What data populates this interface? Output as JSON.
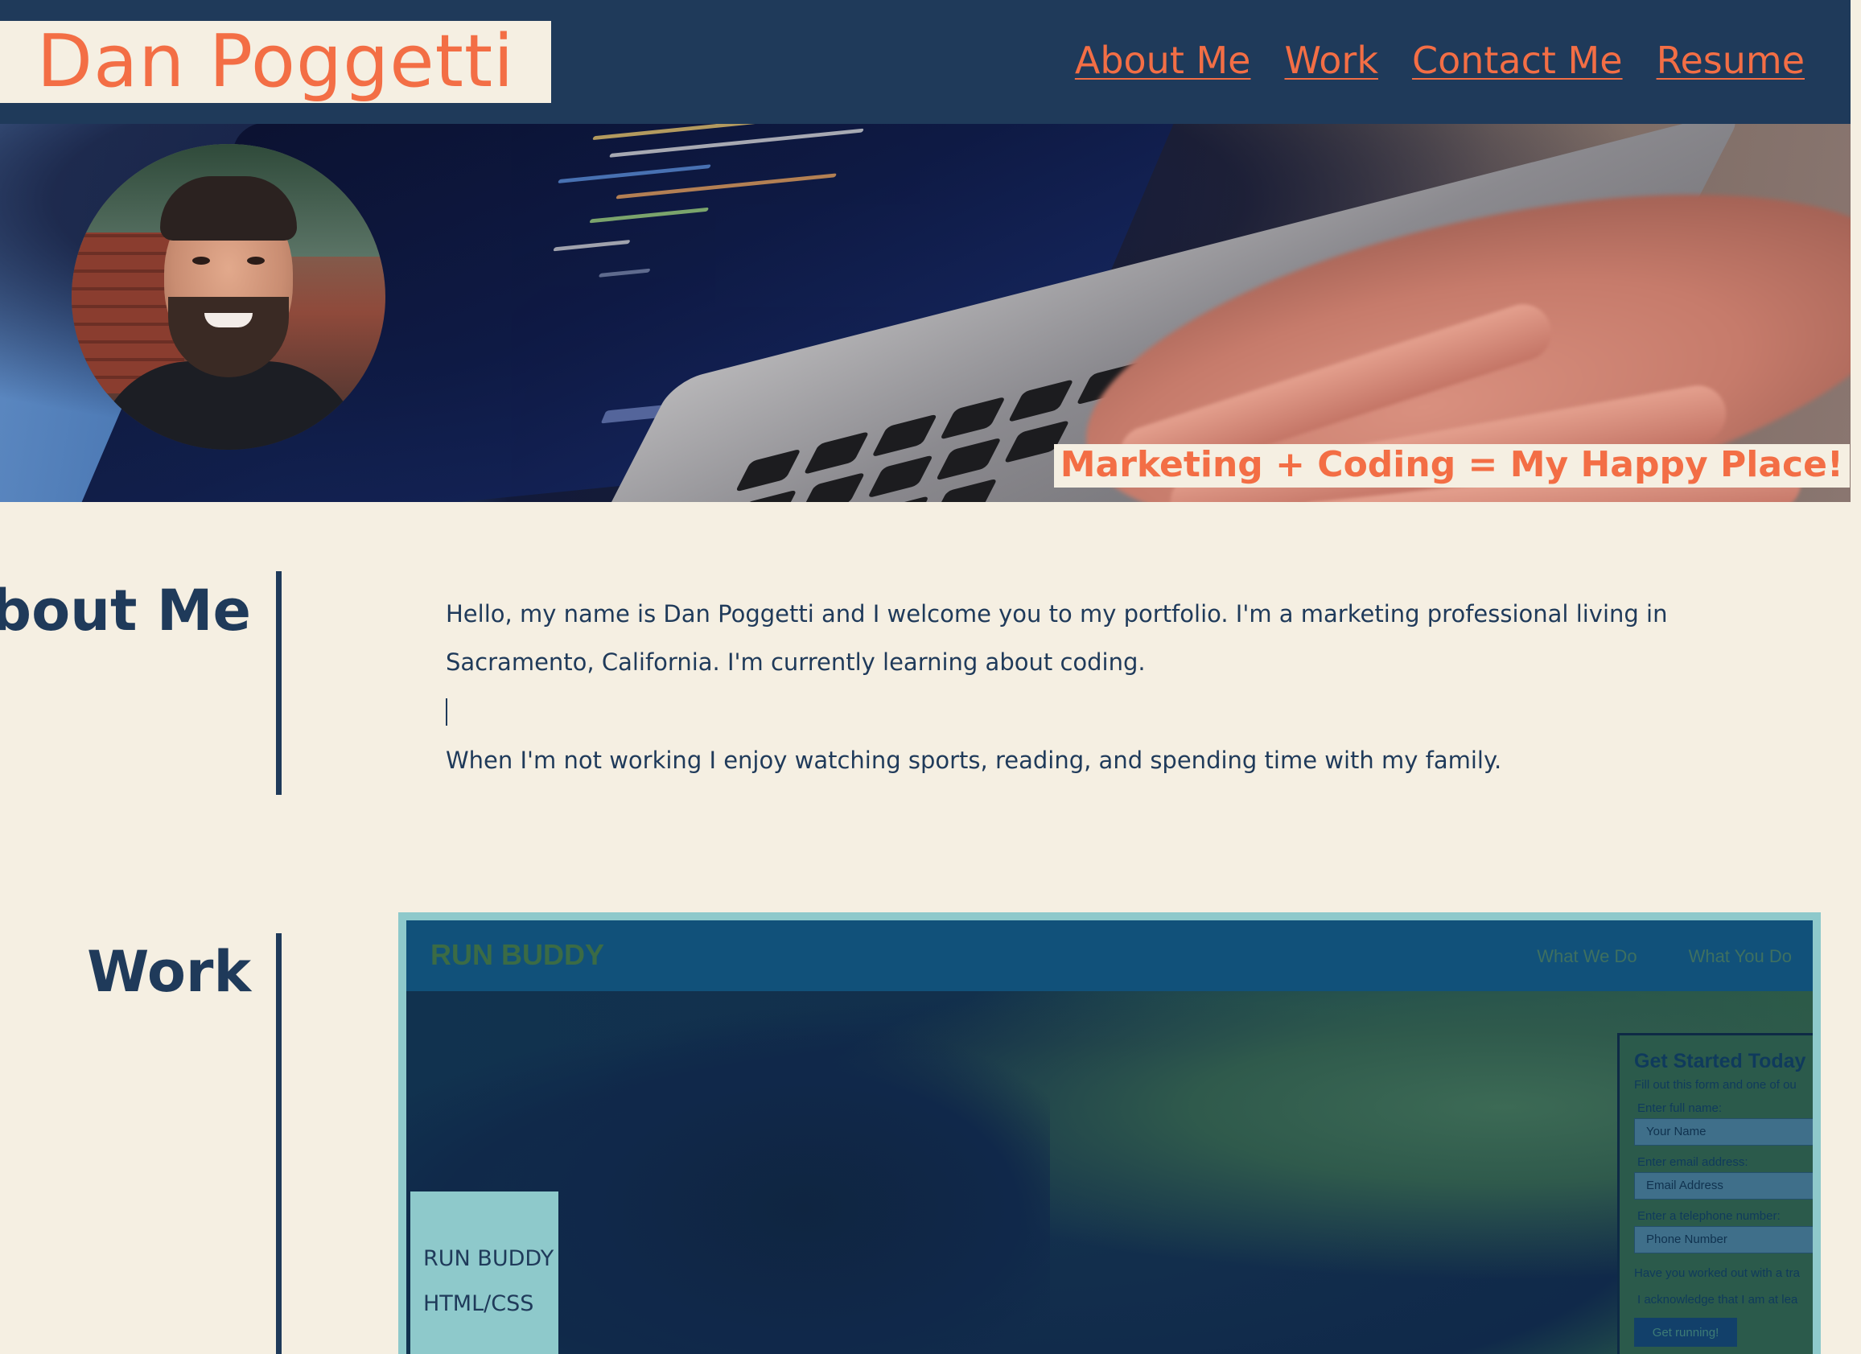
{
  "header": {
    "logo": "Dan Poggetti",
    "nav": [
      {
        "label": "About Me"
      },
      {
        "label": "Work"
      },
      {
        "label": "Contact Me"
      },
      {
        "label": "Resume"
      }
    ]
  },
  "hero": {
    "tagline": "Marketing + Coding = My Happy Place!"
  },
  "about": {
    "title": "About Me",
    "paragraph1": "Hello, my name is Dan Poggetti and I welcome you to my portfolio. I'm a marketing professional living in Sacramento, California. I'm currently learning about coding.",
    "paragraph2": "When I'm not working I enjoy watching sports, reading, and spending time with my family."
  },
  "work": {
    "title": "Work",
    "card": {
      "label_title": "RUN BUDDY",
      "label_tech": "HTML/CSS",
      "preview": {
        "brand": "RUN BUDDY",
        "links": [
          "What We Do",
          "What You Do"
        ],
        "form_title": "Get Started Today",
        "form_subtitle": "Fill out this form and one of ou",
        "name_label": "Enter full name:",
        "name_placeholder": "Your Name",
        "email_label": "Enter email address:",
        "email_placeholder": "Email Address",
        "phone_label": "Enter a telephone number:",
        "phone_placeholder": "Phone Number",
        "question": "Have you worked out with a tra",
        "acknowledge": "I acknowledge that I am at lea",
        "button": "Get running!"
      }
    }
  },
  "colors": {
    "navy": "#1f3a5a",
    "orange": "#f36e45",
    "cream": "#f5efe2",
    "teal": "#8ec9cb"
  }
}
